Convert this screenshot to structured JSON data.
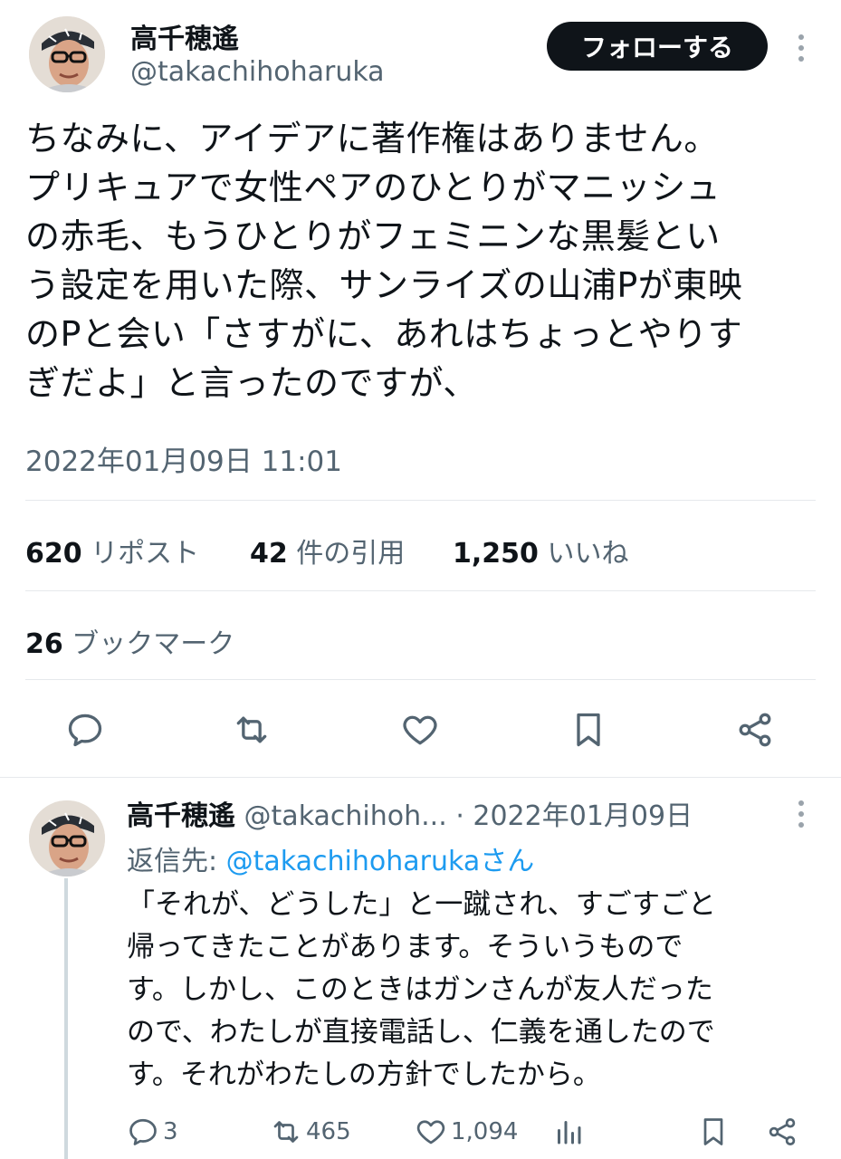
{
  "tweet": {
    "author_name": "高千穂遙",
    "author_handle": "@takachihoharuka",
    "follow_label": "フォローする",
    "text_lines": [
      "ちなみに、アイデアに著作権はありません。",
      "プリキュアで女性ペアのひとりがマニッシュ",
      "の赤毛、もうひとりがフェミニンな黒髪とい",
      "う設定を用いた際、サンライズの山浦Pが東映",
      "のPと会い「さすがに、あれはちょっとやりす",
      "ぎだよ」と言ったのですが、"
    ],
    "timestamp": "2022年01月09日 11:01",
    "stats": {
      "reposts_count": "620",
      "reposts_label": "リポスト",
      "quotes_count": "42",
      "quotes_label": "件の引用",
      "likes_count": "1,250",
      "likes_label": "いいね",
      "bookmarks_count": "26",
      "bookmarks_label": "ブックマーク"
    },
    "actions": [
      "reply-icon",
      "repost-icon",
      "like-icon",
      "bookmark-icon",
      "share-icon"
    ]
  },
  "reply": {
    "author_name": "高千穂遙",
    "author_handle": "@takachihoh...",
    "date": "· 2022年01月09日",
    "replying_to_prefix": "返信先: ",
    "replying_to_handle": "@takachihoharukaさん",
    "text_lines": [
      "「それが、どうした」と一蹴され、すごすごと",
      "帰ってきたことがあります。そういうもので",
      "す。しかし、このときはガンさんが友人だった",
      "ので、わたしが直接電話し、仁義を通したので",
      "す。それがわたしの方針でしたから。"
    ],
    "reply_count": "3",
    "repost_count": "465",
    "like_count": "1,094"
  },
  "colors": {
    "text": "#0f1419",
    "muted": "#536471",
    "link": "#1d9bf0",
    "button_bg": "#0f1419"
  }
}
